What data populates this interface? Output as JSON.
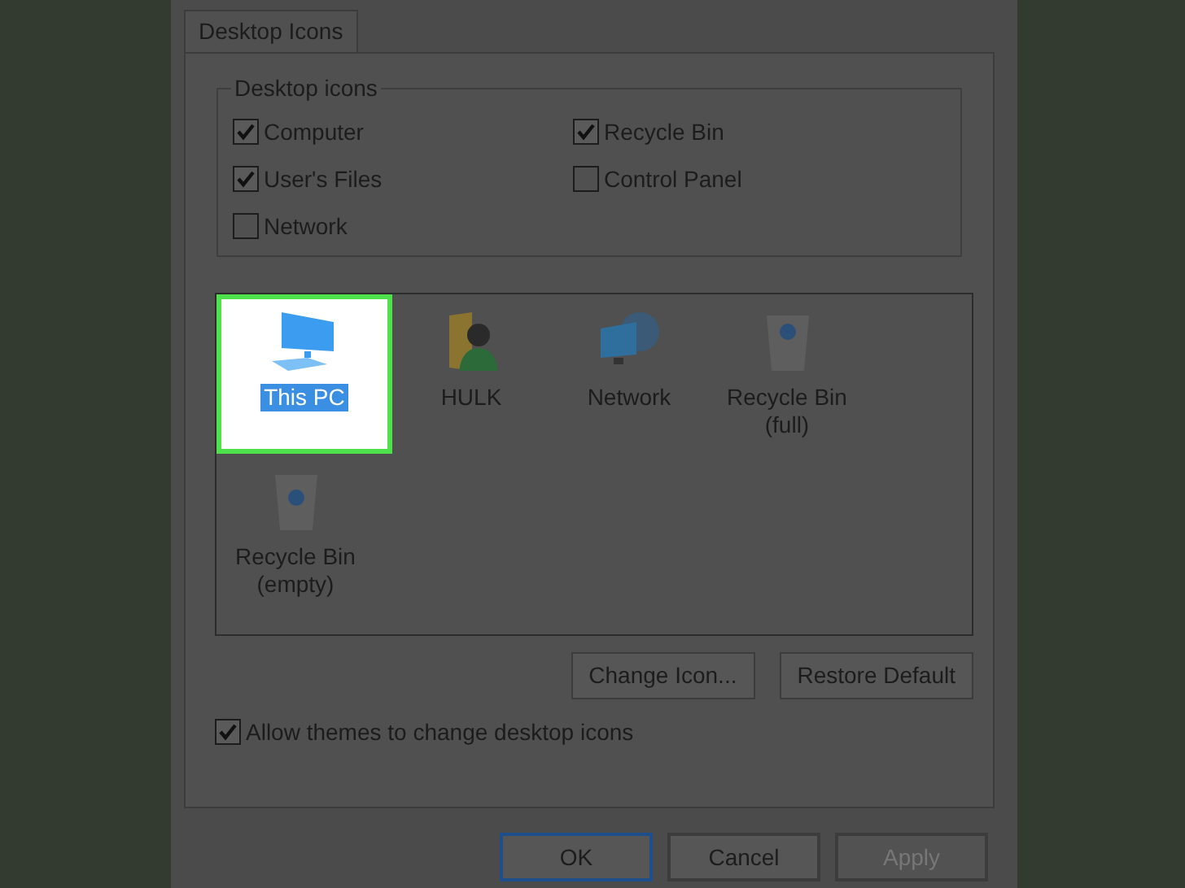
{
  "tabs": [
    {
      "label": "Desktop Icons",
      "selected": true
    }
  ],
  "group": {
    "title": "Desktop icons",
    "checkboxes": [
      {
        "label": "Computer",
        "checked": true
      },
      {
        "label": "Recycle Bin",
        "checked": true
      },
      {
        "label": "User's Files",
        "checked": true
      },
      {
        "label": "Control Panel",
        "checked": false
      },
      {
        "label": "Network",
        "checked": false
      }
    ]
  },
  "icons": [
    {
      "kind": "computer",
      "label": "This PC",
      "selected": true
    },
    {
      "kind": "user",
      "label": "HULK",
      "selected": false
    },
    {
      "kind": "network",
      "label": "Network",
      "selected": false
    },
    {
      "kind": "bin_full",
      "label": "Recycle Bin (full)",
      "selected": false
    },
    {
      "kind": "bin_empty",
      "label": "Recycle Bin (empty)",
      "selected": false
    }
  ],
  "icon_buttons": [
    "Change Icon...",
    "Restore Default"
  ],
  "allow_themes": {
    "label": "Allow themes to change desktop icons",
    "checked": true
  },
  "dialog_buttons": [
    {
      "label": "OK",
      "default": true,
      "disabled": false
    },
    {
      "label": "Cancel",
      "default": false,
      "disabled": false
    },
    {
      "label": "Apply",
      "default": false,
      "disabled": true
    }
  ]
}
